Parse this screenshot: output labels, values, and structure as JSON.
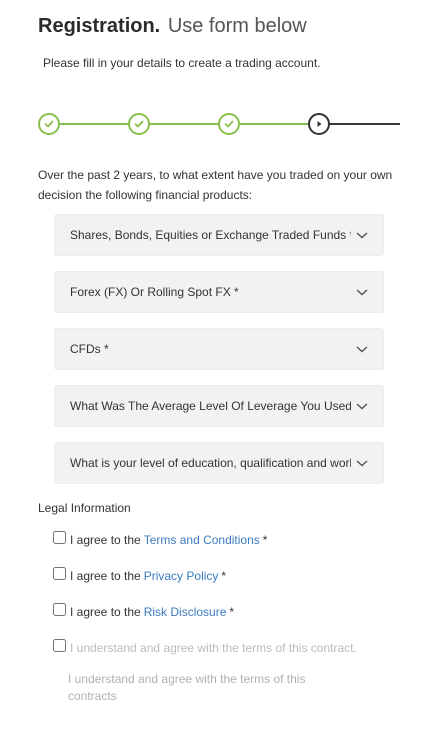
{
  "header": {
    "title_bold": "Registration.",
    "title_light": "Use form below",
    "subtitle": "Please fill in your details to create a trading account."
  },
  "progress": {
    "total_steps": 4,
    "completed_steps": 3,
    "current_step": 4,
    "colors": {
      "done": "#8bbf4d",
      "current": "#333333"
    }
  },
  "question": "Over the past 2 years, to what extent have you traded on your own decision the following financial products:",
  "selects": [
    {
      "label": "Shares, Bonds, Equities or Exchange Traded Funds *"
    },
    {
      "label": "Forex (FX) Or Rolling Spot FX *"
    },
    {
      "label": "CFDs *"
    },
    {
      "label": "What Was The Average Level Of Leverage You Used *"
    },
    {
      "label": "What is your level of education, qualification and work"
    }
  ],
  "legal": {
    "heading": "Legal Information",
    "items": [
      {
        "prefix": "I agree to the",
        "link": "Terms and Conditions",
        "suffix": "*",
        "checked": false
      },
      {
        "prefix": "I agree to the",
        "link": "Privacy Policy",
        "suffix": "*",
        "checked": false
      },
      {
        "prefix": "I agree to the",
        "link": "Risk Disclosure",
        "suffix": "*",
        "checked": false
      }
    ],
    "contract_checkbox_label": "I understand and agree with the terms of this contract.",
    "contract_note": "I understand and agree with the terms of this contracts"
  },
  "colors": {
    "accent": "#8bbf4d",
    "link": "#3b7bbf",
    "field_bg": "#f2f2f2"
  }
}
